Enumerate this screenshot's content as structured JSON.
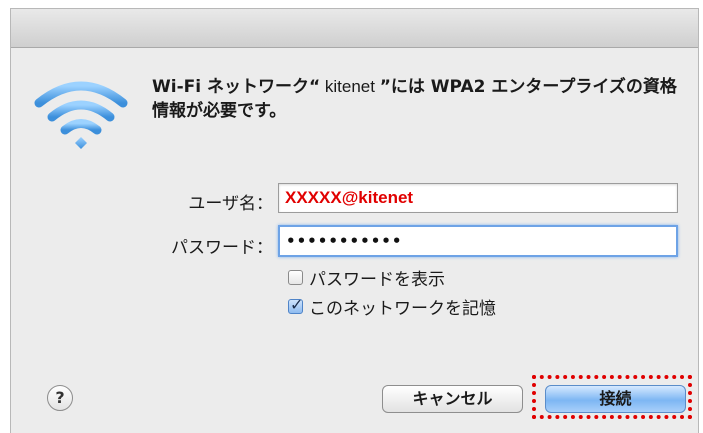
{
  "dialog": {
    "message_part1": "Wi-Fi ネットワーク“",
    "ssid": " kitenet ",
    "message_part2": "”には WPA2 エンタープライズの資格情報が必要です。"
  },
  "form": {
    "username_label": "ユーザ名：",
    "username_value": "XXXXX@kitenet",
    "password_label": "パスワード：",
    "password_value": "•••••••••••",
    "show_password_label": "パスワードを表示",
    "show_password_checked": false,
    "remember_network_label": "このネットワークを記憶",
    "remember_network_checked": true
  },
  "buttons": {
    "help_label": "?",
    "cancel_label": "キャンセル",
    "connect_label": "接続"
  },
  "icons": {
    "wifi": "wifi-icon",
    "help": "help-icon",
    "checkmark": "checkmark-icon"
  },
  "colors": {
    "highlight": "#e00000",
    "username_text": "#e10000",
    "wifi_icon": "#5aa7e8",
    "default_button": "#7db6f3"
  }
}
